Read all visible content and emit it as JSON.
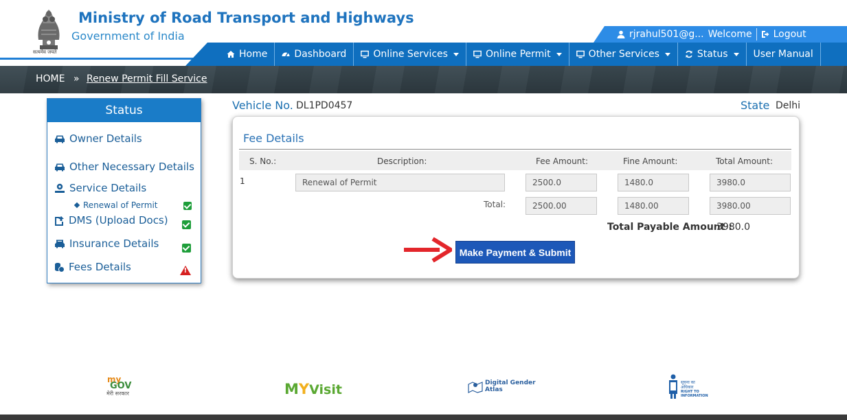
{
  "header": {
    "title": "Ministry of Road Transport and Highways",
    "subtitle": "Government of India",
    "emblem_motto": "सत्यमेव जयते",
    "user": "rjrahul501@g...",
    "welcome": "Welcome",
    "logout": "Logout"
  },
  "nav": {
    "home": "Home",
    "dashboard": "Dashboard",
    "online_services": "Online Services",
    "online_permit": "Online Permit",
    "other_services": "Other Services",
    "status": "Status",
    "user_manual": "User Manual"
  },
  "breadcrumb": {
    "home": "HOME",
    "separator": "»",
    "current": "Renew Permit Fill Service"
  },
  "sidebar": {
    "title": "Status",
    "items": {
      "owner": "Owner Details",
      "other": "Other Necessary Details",
      "service": "Service Details",
      "service_sub": "Renewal of Permit",
      "dms": "DMS (Upload Docs)",
      "insurance": "Insurance Details",
      "fees": "Fees Details"
    }
  },
  "vehicle": {
    "label": "Vehicle No.",
    "value": "DL1PD0457"
  },
  "state": {
    "label": "State",
    "value": "Delhi"
  },
  "fee_details": {
    "title": "Fee Details",
    "headers": {
      "sno": "S. No.:",
      "description": "Description:",
      "fee": "Fee Amount:",
      "fine": "Fine Amount:",
      "total": "Total Amount:"
    },
    "row": {
      "sno": "1",
      "description": "Renewal of Permit",
      "fee": "2500.0",
      "fine": "1480.0",
      "total": "3980.0"
    },
    "totals": {
      "label": "Total:",
      "fee": "2500.00",
      "fine": "1480.00",
      "total": "3980.00"
    },
    "payable_label": "Total Payable Amount :",
    "payable_value": "3980.0",
    "submit_label": "Make Payment & Submit"
  },
  "footer": {
    "mygov": {
      "my": "my",
      "gov": "GOV",
      "tag": "मेरी सरकार"
    },
    "myvisit": {
      "m": "M",
      "y": "Y",
      "visit": "Visit"
    },
    "gender_atlas": {
      "line1": "Digital Gender",
      "line2": "Atlas"
    },
    "rti": {
      "line1": "सूचना का",
      "line2": "अधिकार",
      "line3": "RIGHT TO",
      "line4": "INFORMATION"
    }
  },
  "colors": {
    "primary": "#0f6fbf",
    "accent": "#2d8ce6",
    "button": "#1d58b8",
    "check": "#1e9e3a",
    "warning": "#d62020",
    "arrow": "#e3262b"
  }
}
